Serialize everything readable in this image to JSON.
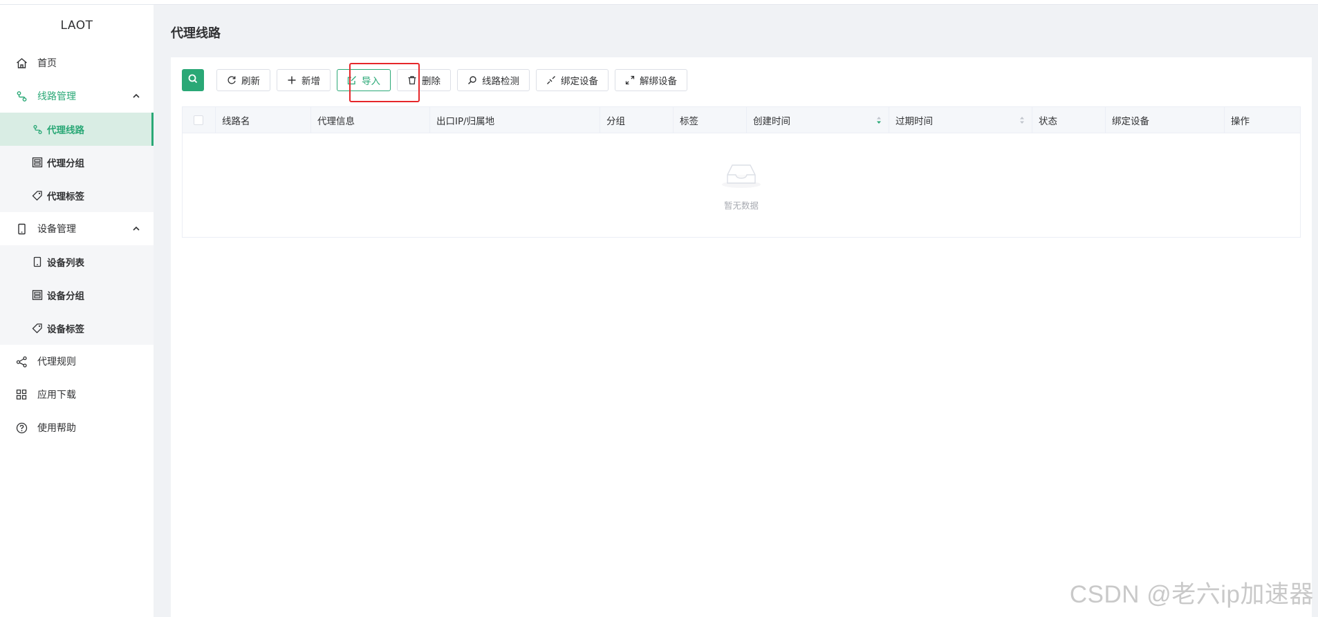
{
  "app": {
    "logo": "LAOT"
  },
  "sidebar": {
    "home": "首页",
    "line_mgmt": {
      "label": "线路管理",
      "items": [
        "代理线路",
        "代理分组",
        "代理标签"
      ]
    },
    "device_mgmt": {
      "label": "设备管理",
      "items": [
        "设备列表",
        "设备分组",
        "设备标签"
      ]
    },
    "proxy_rules": "代理规则",
    "app_download": "应用下载",
    "help": "使用帮助"
  },
  "page": {
    "title": "代理线路"
  },
  "toolbar": {
    "refresh": "刷新",
    "add": "新增",
    "import": "导入",
    "delete": "删除",
    "check": "线路检测",
    "bind": "绑定设备",
    "unbind": "解绑设备"
  },
  "table": {
    "columns": [
      "线路名",
      "代理信息",
      "出口IP/归属地",
      "分组",
      "标签",
      "创建时间",
      "过期时间",
      "状态",
      "绑定设备",
      "操作"
    ],
    "empty_text": "暂无数据"
  },
  "watermark": "CSDN @老六ip加速器",
  "colors": {
    "primary": "#2aa876",
    "highlight": "#e5262a"
  }
}
